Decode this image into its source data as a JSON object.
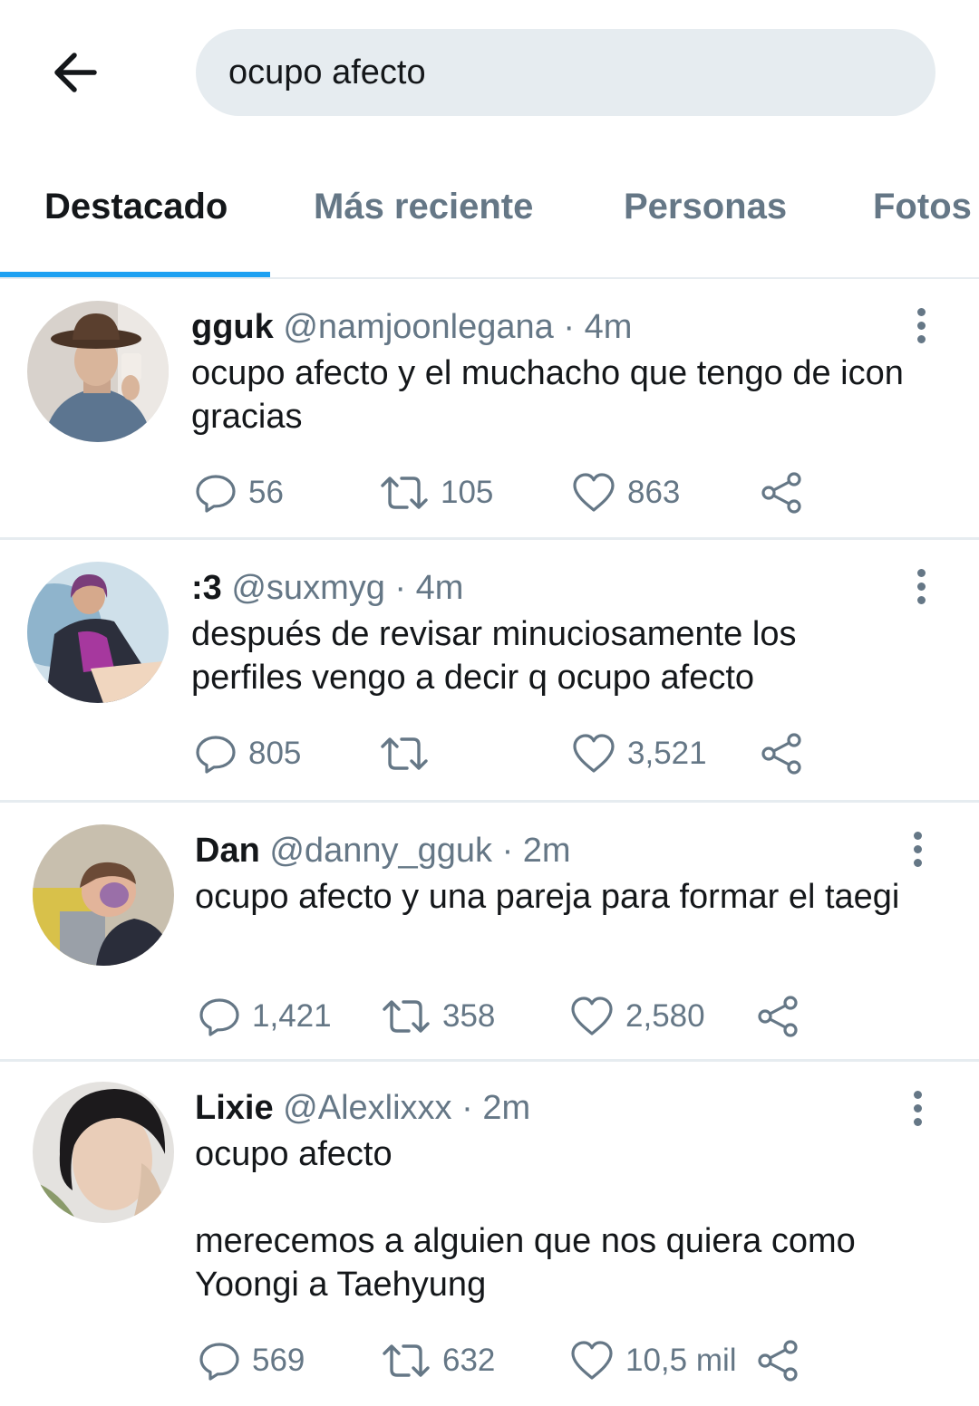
{
  "search": {
    "query": "ocupo afecto"
  },
  "tabs": [
    {
      "label": "Destacado",
      "active": true
    },
    {
      "label": "Más reciente"
    },
    {
      "label": "Personas"
    },
    {
      "label": "Fotos"
    }
  ],
  "colors": {
    "accent": "#1da1f2",
    "secondary_text": "#657786",
    "primary_text": "#14171a",
    "search_bg": "#e6ecf0"
  },
  "tweets": [
    {
      "name": "gguk",
      "handle": "@namjoonlegana",
      "time": "· 4m",
      "text": [
        "ocupo afecto y el muchacho que tengo de icon gracias"
      ],
      "replies": "56",
      "retweets": "105",
      "likes": "863"
    },
    {
      "name": ":3",
      "handle": "@suxmyg",
      "time": "· 4m",
      "text": [
        "después de revisar minuciosamente los perfiles vengo a decir q ocupo afecto"
      ],
      "replies": "805",
      "retweets": "",
      "likes": "3,521"
    },
    {
      "name": "Dan",
      "handle": "@danny_gguk",
      "time": "· 2m",
      "text": [
        "ocupo afecto y una pareja para formar el taegi"
      ],
      "replies": "1,421",
      "retweets": "358",
      "likes": "2,580"
    },
    {
      "name": "Lixie",
      "handle": "@Alexlixxx",
      "time": "· 2m",
      "text": [
        "ocupo afecto",
        "merecemos a alguien que nos quiera como Yoongi a Taehyung"
      ],
      "replies": "569",
      "retweets": "632",
      "likes": "10,5 mil"
    }
  ]
}
